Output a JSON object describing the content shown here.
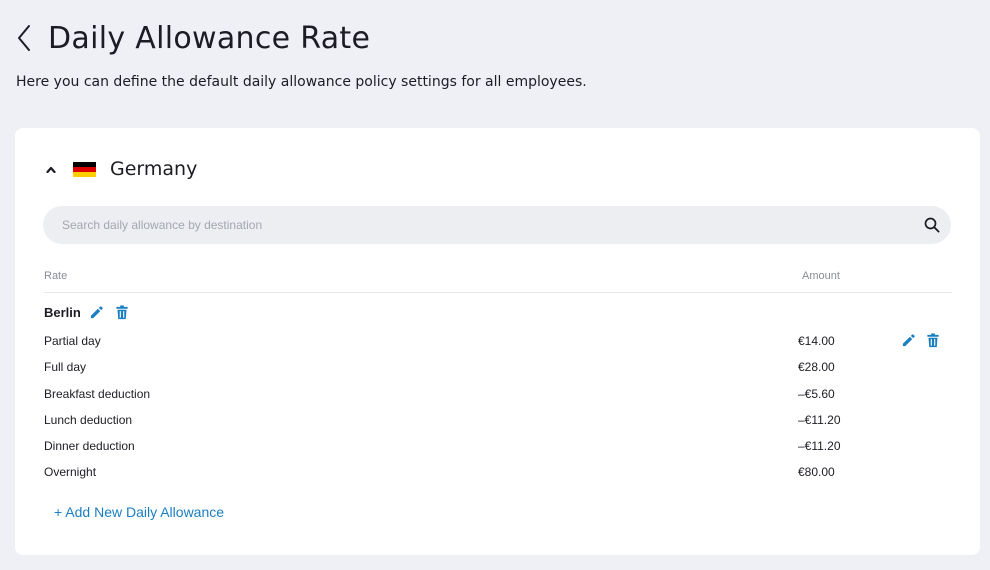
{
  "header": {
    "title": "Daily Allowance Rate",
    "description": "Here you can define the default daily allowance policy settings for all employees."
  },
  "country": {
    "name": "Germany",
    "flag_colors": [
      "#000000",
      "#dd0000",
      "#ffce00"
    ]
  },
  "search": {
    "placeholder": "Search daily allowance by destination",
    "value": ""
  },
  "table": {
    "headers": {
      "rate": "Rate",
      "amount": "Amount"
    },
    "city": "Berlin",
    "rows": [
      {
        "label": "Partial day",
        "amount": "€14.00"
      },
      {
        "label": "Full day",
        "amount": "€28.00"
      },
      {
        "label": "Breakfast deduction",
        "amount": "–€5.60"
      },
      {
        "label": "Lunch deduction",
        "amount": "–€11.20"
      },
      {
        "label": "Dinner deduction",
        "amount": "–€11.20"
      },
      {
        "label": "Overnight",
        "amount": "€80.00"
      }
    ]
  },
  "add_link": "+ Add New Daily Allowance",
  "colors": {
    "accent": "#1a7fc1",
    "background": "#eff0f5",
    "card": "#ffffff"
  },
  "icons": {
    "back": "chevron-left-icon",
    "collapse": "chevron-up-icon",
    "search": "search-icon",
    "edit": "pencil-icon",
    "delete": "trash-icon"
  }
}
